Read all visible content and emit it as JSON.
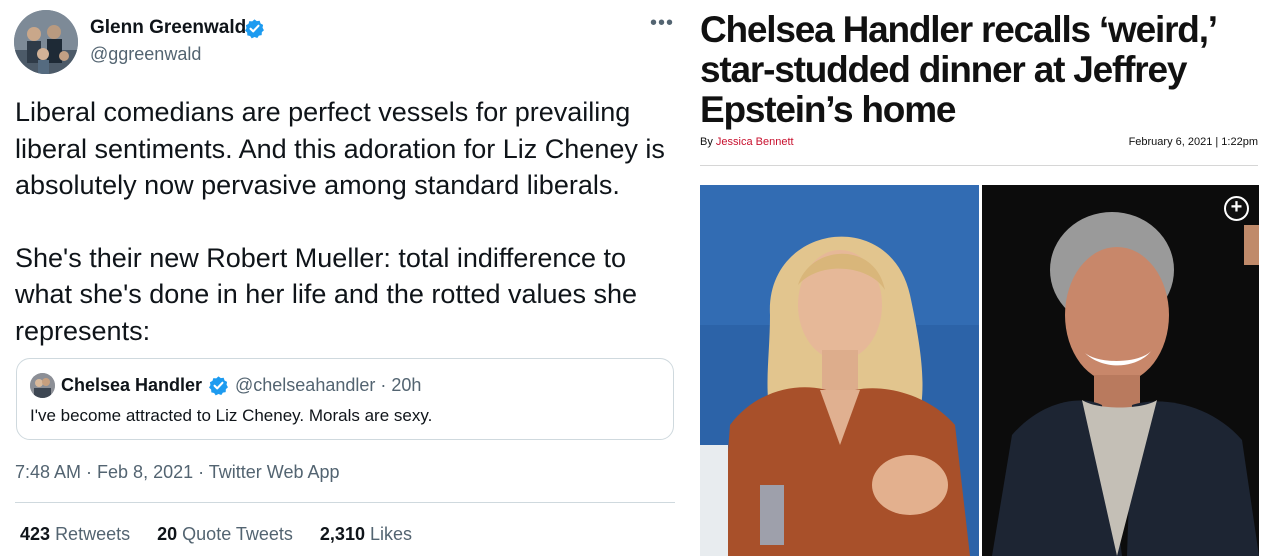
{
  "tweet": {
    "author_name": "Glenn Greenwald",
    "author_handle": "@ggreenwald",
    "more_icon": "more-horizontal-icon",
    "paragraphs": [
      "Liberal comedians are perfect vessels for prevailing liberal sentiments. And this adoration for Liz Cheney is absolutely now pervasive among standard liberals.",
      "She's their new Robert Mueller: total indifference to what she's done in her life and the rotted values she represents:"
    ],
    "quoted": {
      "author_name": "Chelsea Handler",
      "meta": "@chelseahandler · 20h",
      "text": "I've become attracted to Liz Cheney. Morals are sexy."
    },
    "timestamp": "7:48 AM · Feb 8, 2021 · Twitter Web App",
    "stats": {
      "retweets_count": "423",
      "retweets_label": "Retweets",
      "quotes_count": "20",
      "quotes_label": "Quote Tweets",
      "likes_count": "2,310",
      "likes_label": "Likes"
    },
    "colors": {
      "text": "#0f1419",
      "secondary": "#536471",
      "verified": "#1d9bf0",
      "border": "#cfd9de"
    }
  },
  "article": {
    "headline": "Chelsea Handler recalls ‘weird,’ star-studded dinner at Jeffrey Epstein’s home",
    "byline_prefix": "By",
    "byline_author": "Jessica Bennett",
    "date": "February 6, 2021 | 1:22pm",
    "expand_icon": "plus-circle-icon",
    "colors": {
      "byline_author": "#c8102e",
      "headline": "#111111"
    }
  }
}
